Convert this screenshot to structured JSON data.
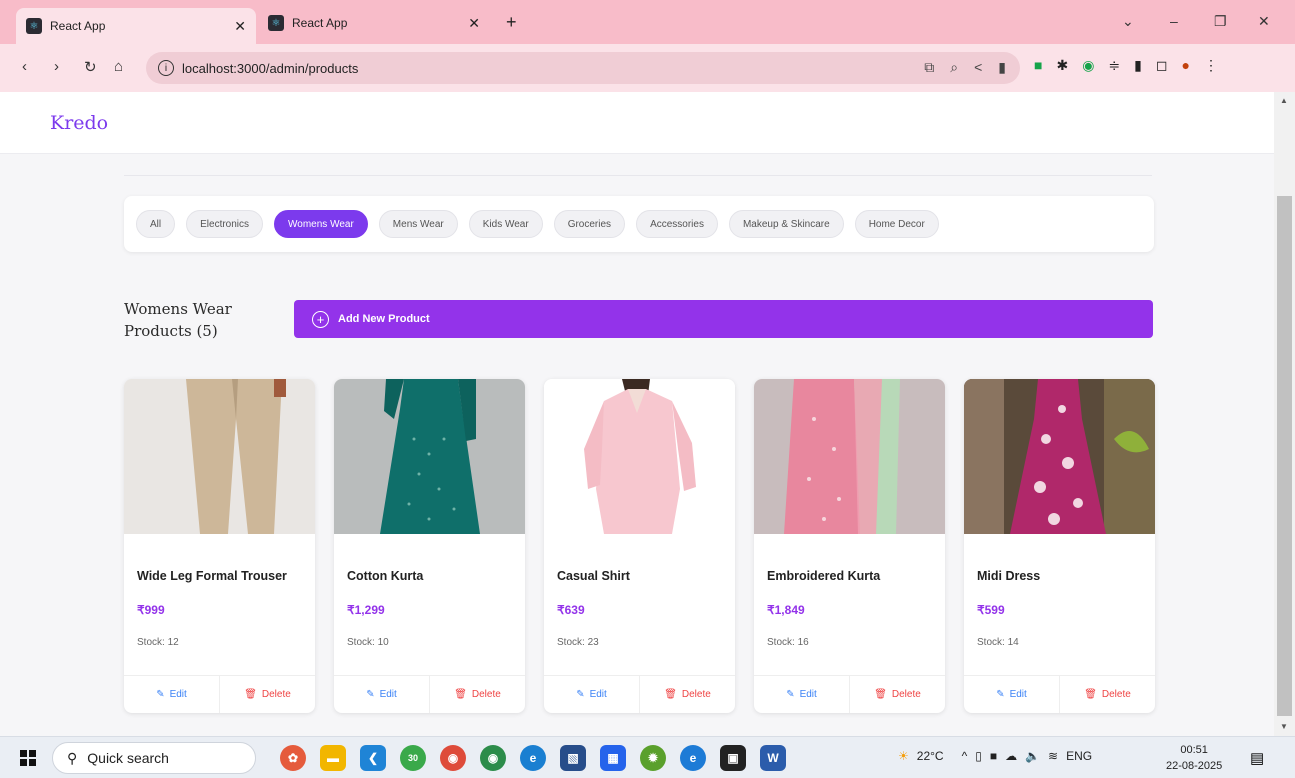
{
  "browser": {
    "tabs": [
      {
        "title": "React App",
        "active": true
      },
      {
        "title": "React App",
        "active": false
      }
    ],
    "url": "localhost:3000/admin/products"
  },
  "app": {
    "logo": "Kredo",
    "brand_color": "#7c3aed"
  },
  "filters": {
    "selected": "Womens Wear",
    "chips": [
      "All",
      "Electronics",
      "Womens Wear",
      "Mens Wear",
      "Kids Wear",
      "Groceries",
      "Accessories",
      "Makeup & Skincare",
      "Home Decor"
    ]
  },
  "section": {
    "title": "Womens Wear Products (5)",
    "add_button": "Add New Product"
  },
  "products": [
    {
      "name": "Wide Leg Formal Trouser",
      "price": "₹999",
      "stock": "Stock: 12",
      "edit": "Edit",
      "delete": "Delete"
    },
    {
      "name": "Cotton Kurta",
      "price": "₹1,299",
      "stock": "Stock: 10",
      "edit": "Edit",
      "delete": "Delete"
    },
    {
      "name": "Casual Shirt",
      "price": "₹639",
      "stock": "Stock: 23",
      "edit": "Edit",
      "delete": "Delete"
    },
    {
      "name": "Embroidered Kurta",
      "price": "₹1,849",
      "stock": "Stock: 16",
      "edit": "Edit",
      "delete": "Delete"
    },
    {
      "name": "Midi Dress",
      "price": "₹599",
      "stock": "Stock: 14",
      "edit": "Edit",
      "delete": "Delete"
    }
  ],
  "taskbar": {
    "search_placeholder": "Quick search",
    "whatsapp_badge": "30",
    "weather": "22°C",
    "language": "ENG",
    "time": "00:51",
    "date": "22-08-2025"
  }
}
